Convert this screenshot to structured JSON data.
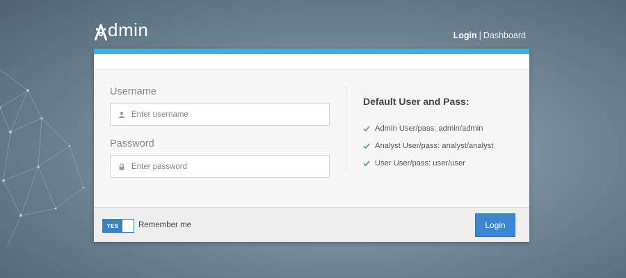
{
  "brand": {
    "logo_text": "dmin",
    "logo_letter": "A"
  },
  "topnav": {
    "login": "Login",
    "separator": "|",
    "dashboard": "Dashboard"
  },
  "form": {
    "username_label": "Username",
    "username_placeholder": "Enter username",
    "password_label": "Password",
    "password_placeholder": "Enter password"
  },
  "info": {
    "title": "Default User and Pass:",
    "items": [
      "Admin User/pass: admin/admin",
      "Analyst User/pass: analyst/analyst",
      "User User/pass: user/user"
    ]
  },
  "footer": {
    "toggle_label": "YES",
    "remember_label": "Remember me",
    "login_button": "Login"
  },
  "colors": {
    "accent_bar": "#3fb0de",
    "primary_button": "#3b87d4",
    "check": "#5cb85c"
  }
}
